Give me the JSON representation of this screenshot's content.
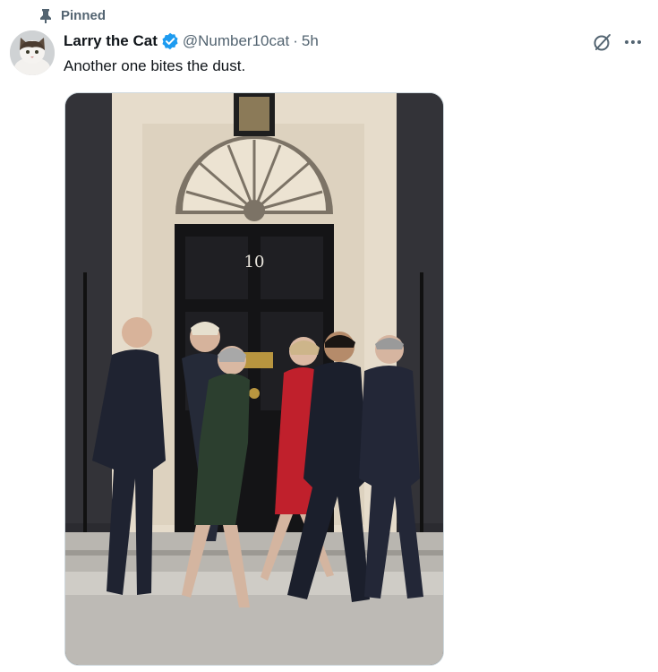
{
  "pinned": {
    "label": "Pinned"
  },
  "tweet": {
    "author_name": "Larry the Cat",
    "handle": "@Number10cat",
    "separator": "·",
    "time": "5h",
    "text": "Another one bites the dust.",
    "media": {
      "door_number": "10"
    }
  },
  "icons": {
    "pin": "pin-icon",
    "verified": "verified-badge-icon",
    "grok": "grok-icon",
    "more": "more-dots-icon"
  },
  "colors": {
    "verified": "#1d9bf0",
    "secondary_text": "#536471",
    "primary_text": "#0f1419"
  }
}
